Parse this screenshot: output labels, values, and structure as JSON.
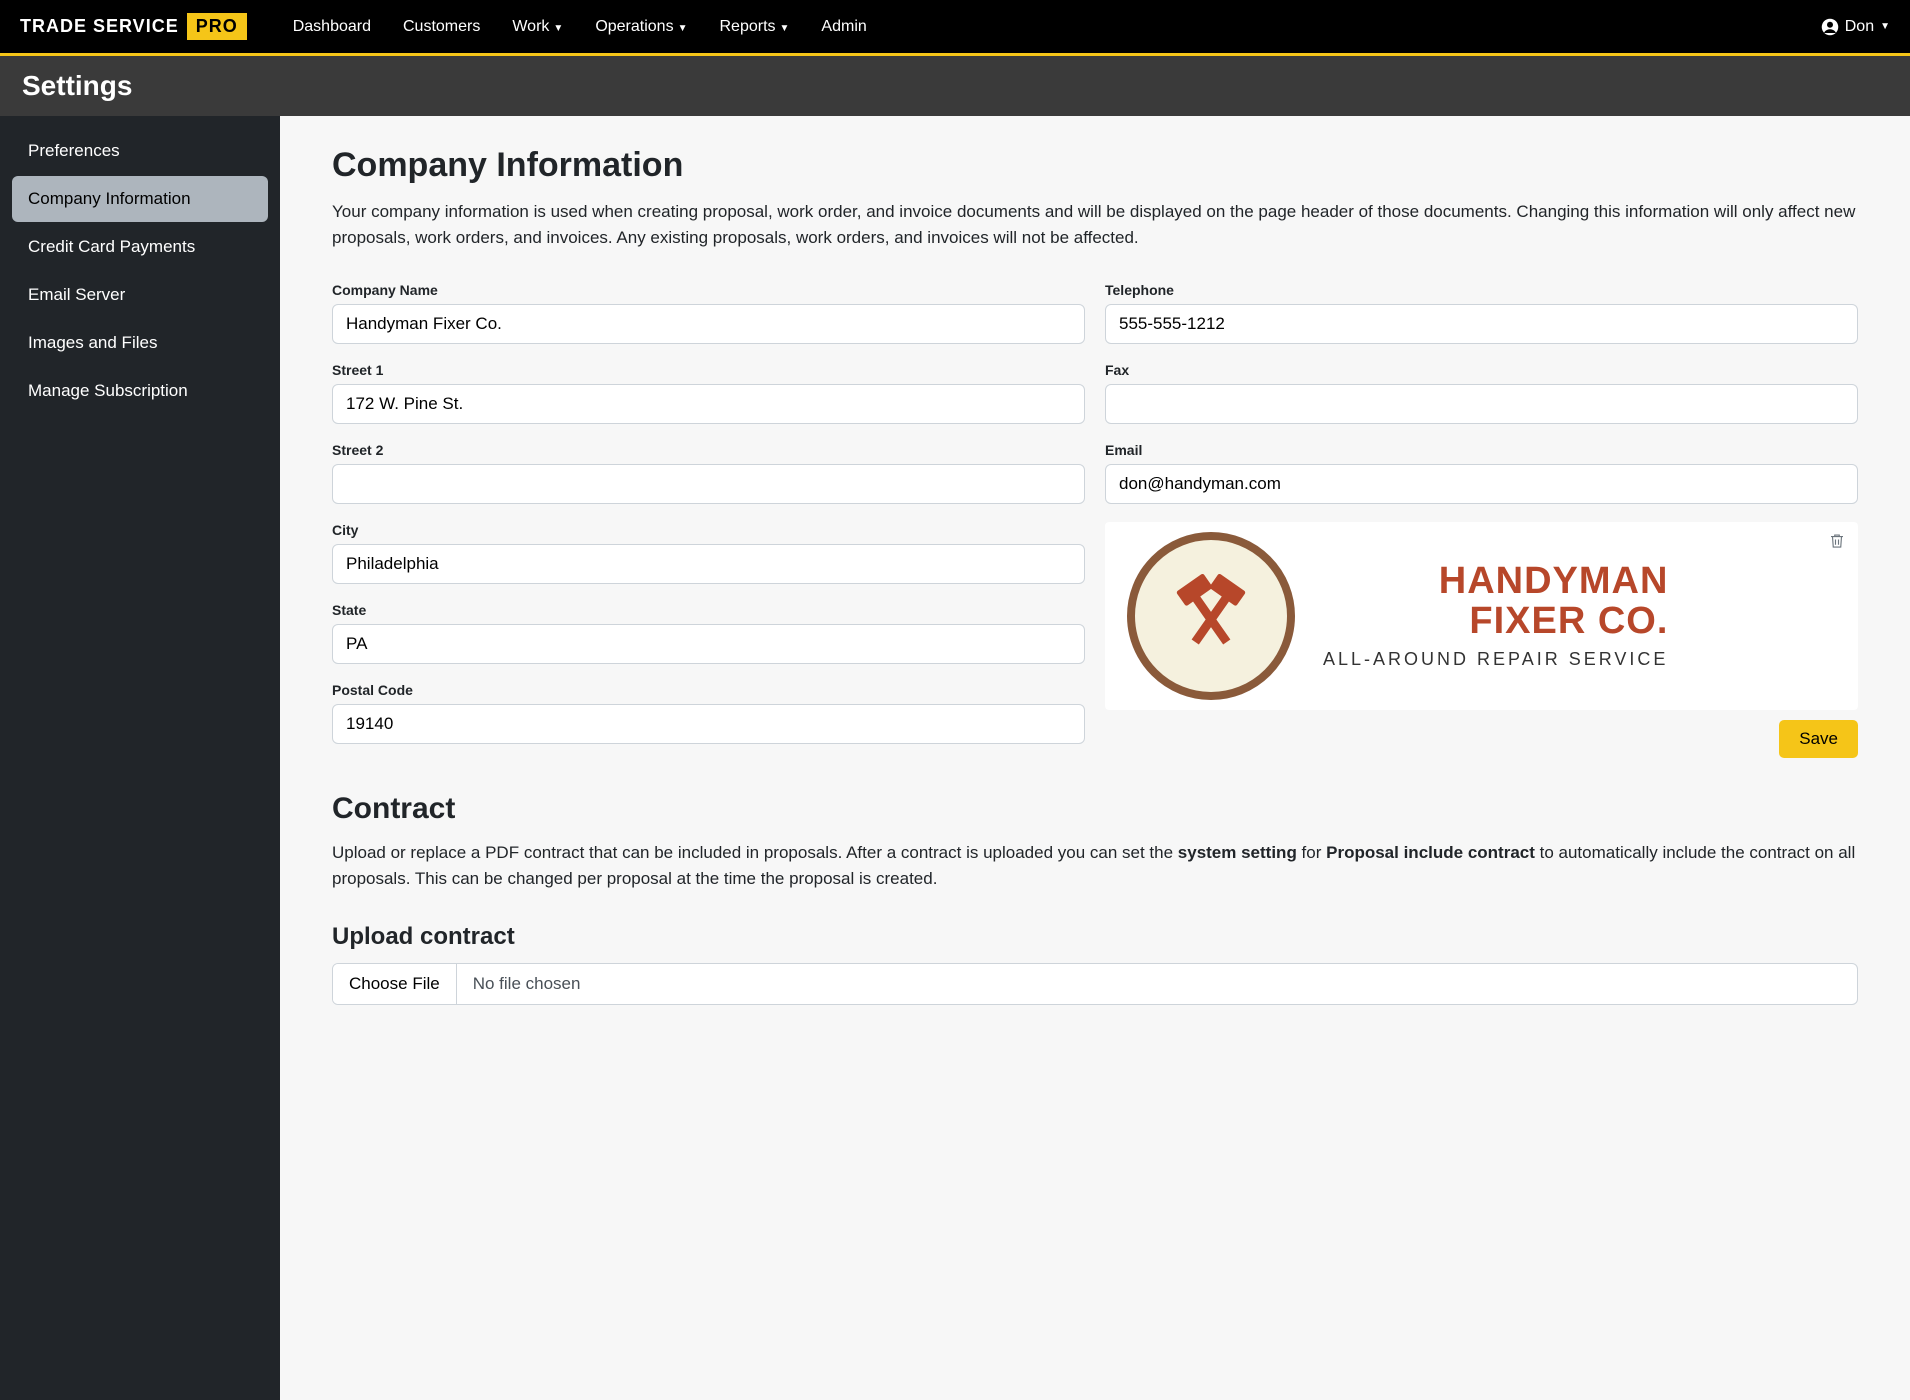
{
  "brand": {
    "name": "TRADE SERVICE",
    "badge": "PRO"
  },
  "nav": {
    "dashboard": "Dashboard",
    "customers": "Customers",
    "work": "Work",
    "operations": "Operations",
    "reports": "Reports",
    "admin": "Admin"
  },
  "user": {
    "name": "Don"
  },
  "page_title": "Settings",
  "sidebar": {
    "items": [
      {
        "label": "Preferences"
      },
      {
        "label": "Company Information"
      },
      {
        "label": "Credit Card Payments"
      },
      {
        "label": "Email Server"
      },
      {
        "label": "Images and Files"
      },
      {
        "label": "Manage Subscription"
      }
    ]
  },
  "section": {
    "title": "Company Information",
    "description": "Your company information is used when creating proposal, work order, and invoice documents and will be displayed on the page header of those documents. Changing this information will only affect new proposals, work orders, and invoices. Any existing proposals, work orders, and invoices will not be affected."
  },
  "form": {
    "company_name": {
      "label": "Company Name",
      "value": "Handyman Fixer Co."
    },
    "street1": {
      "label": "Street 1",
      "value": "172 W. Pine St."
    },
    "street2": {
      "label": "Street 2",
      "value": ""
    },
    "city": {
      "label": "City",
      "value": "Philadelphia"
    },
    "state": {
      "label": "State",
      "value": "PA"
    },
    "postal_code": {
      "label": "Postal Code",
      "value": "19140"
    },
    "telephone": {
      "label": "Telephone",
      "value": "555-555-1212"
    },
    "fax": {
      "label": "Fax",
      "value": ""
    },
    "email": {
      "label": "Email",
      "value": "don@handyman.com"
    }
  },
  "logo": {
    "title_l1": "HANDYMAN",
    "title_l2": "FIXER CO.",
    "subtitle": "ALL-AROUND REPAIR SERVICE"
  },
  "save_label": "Save",
  "contract": {
    "title": "Contract",
    "desc_1": "Upload or replace a PDF contract that can be included in proposals. After a contract is uploaded you can set the ",
    "desc_bold1": "system setting",
    "desc_2": " for ",
    "desc_bold2": "Proposal include contract",
    "desc_3": " to automatically include the contract on all proposals. This can be changed per proposal at the time the proposal is created.",
    "upload_title": "Upload contract",
    "choose_file": "Choose File",
    "no_file": "No file chosen"
  }
}
